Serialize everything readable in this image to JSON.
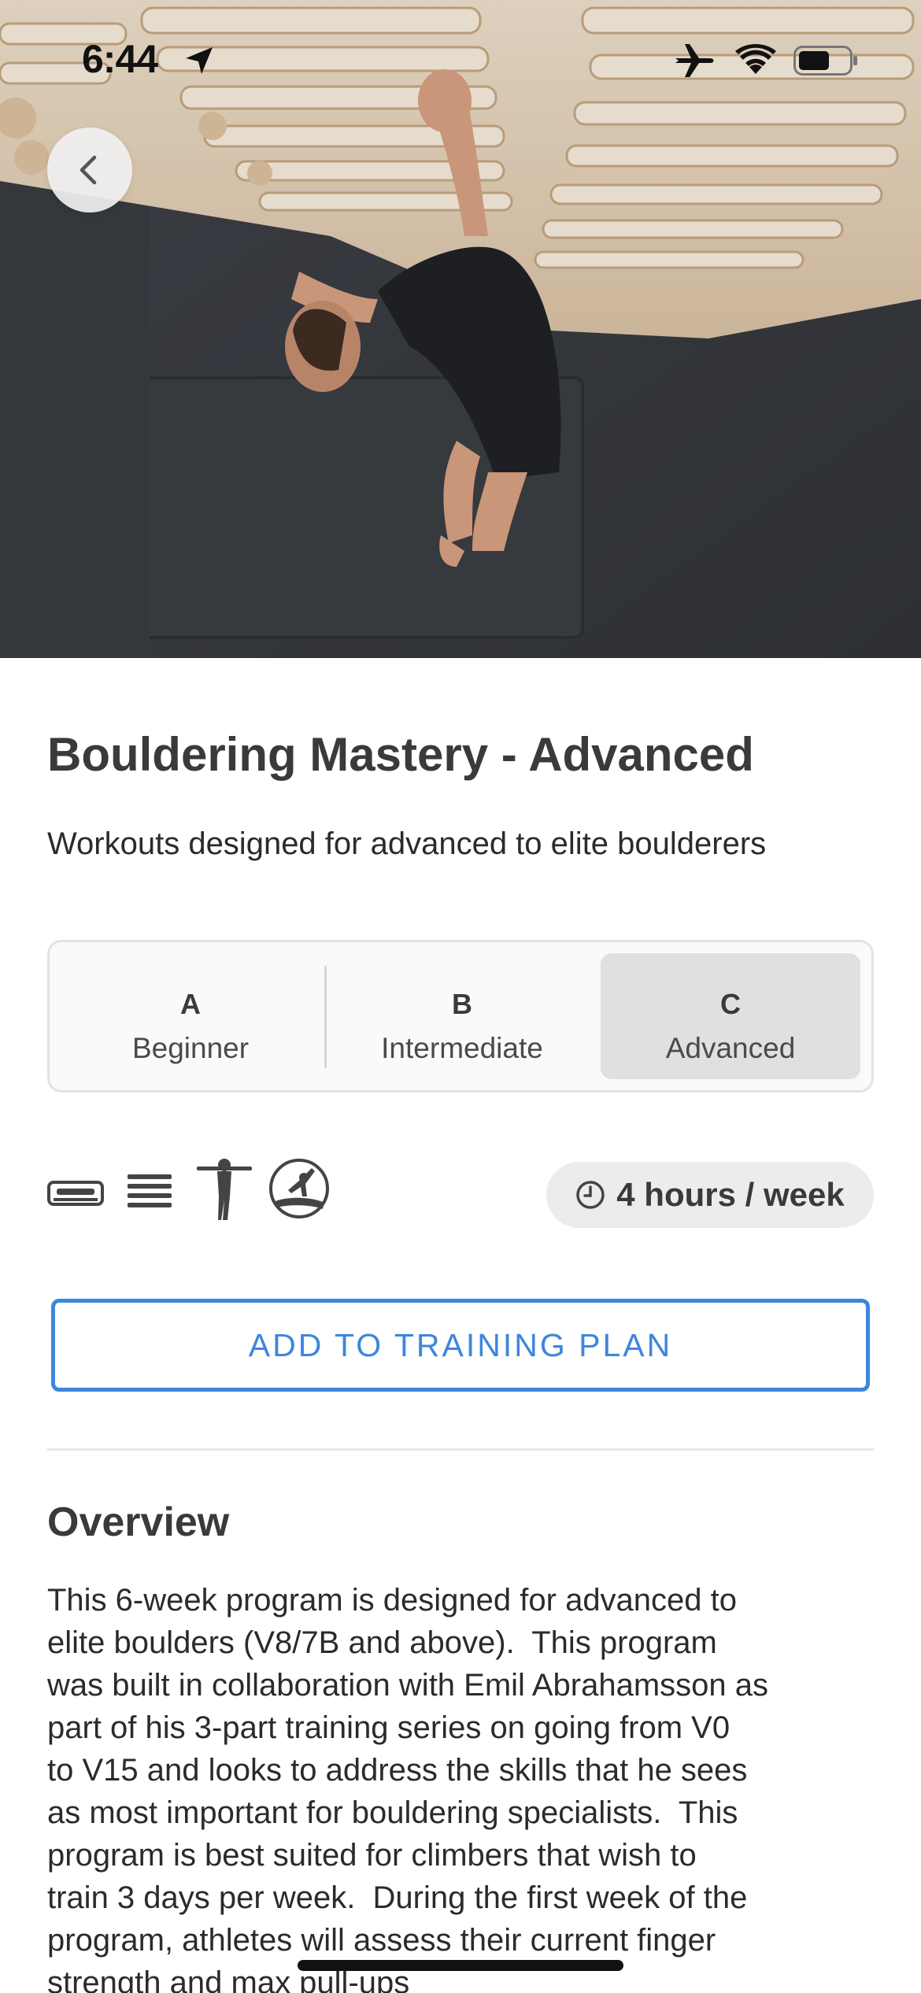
{
  "status_bar": {
    "time": "6:44",
    "icons": [
      "location-arrow-icon",
      "airplane-icon",
      "wifi-icon",
      "battery-icon"
    ]
  },
  "nav": {
    "back_icon": "chevron-left-icon"
  },
  "hero": {
    "image": "climber-on-training-board-photo"
  },
  "program": {
    "title": "Bouldering Mastery - Advanced",
    "subtitle": "Workouts designed for advanced to elite boulderers",
    "levels": [
      {
        "letter": "A",
        "name": "Beginner",
        "selected": false
      },
      {
        "letter": "B",
        "name": "Intermediate",
        "selected": false
      },
      {
        "letter": "C",
        "name": "Advanced",
        "selected": true
      }
    ],
    "equipment_icons": [
      "hangboard-icon",
      "campus-board-icon",
      "pull-up-figure-icon",
      "bouldering-icon"
    ],
    "duration": "4 hours / week",
    "duration_icon": "clock-icon",
    "add_button": "ADD TO TRAINING PLAN"
  },
  "overview": {
    "heading": "Overview",
    "body": "This 6-week program is designed for advanced to\nelite boulders (V8/7B and above).  This program\nwas built in collaboration with Emil Abrahamsson as\npart of his 3-part training series on going from V0\nto V15 and looks to address the skills that he sees\nas most important for bouldering specialists.  This\nprogram is best suited for climbers that wish to\ntrain 3 days per week.  During the first week of the\nprogram, athletes will assess their current finger\nstrength and max pull-ups"
  },
  "colors": {
    "accent": "#3d86dc",
    "selected_segment": "#e0e0e0",
    "pill_bg": "#ececec",
    "text": "#333333"
  }
}
